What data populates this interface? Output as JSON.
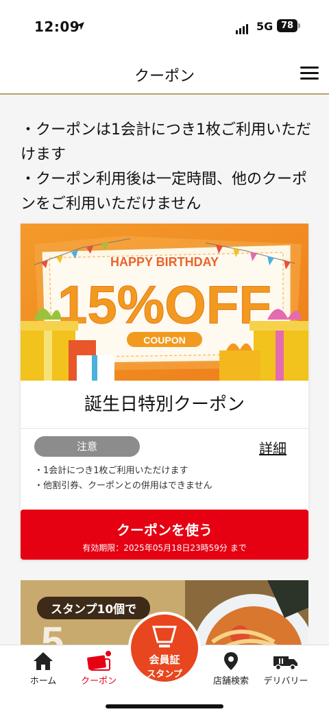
{
  "status_bar": {
    "time": "12:09",
    "network": "5G",
    "battery": "78"
  },
  "header": {
    "title": "クーポン"
  },
  "notice": {
    "line1": "・クーポンは1会計につき1枚ご利用いただけます",
    "line2": "・クーポン利用後は一定時間、他のクーポンをご利用いただけません"
  },
  "coupon": {
    "banner": {
      "top_text": "HAPPY BIRTHDAY",
      "discount": "15%OFF",
      "tag": "COUPON"
    },
    "name": "誕生日特別クーポン",
    "caution_label": "注意",
    "detail_link": "詳細",
    "rules": [
      "・1会計につき1枚ご利用いただけます",
      "・他割引券、クーポンとの併用はできません"
    ],
    "use_button": "クーポンを使う",
    "expiry": "有効期限：2025年05月18日23時59分 まで"
  },
  "coupon2": {
    "stamp_text": "スタンプ10個で"
  },
  "tabs": [
    {
      "label": "ホーム",
      "icon": "home-icon"
    },
    {
      "label": "クーポン",
      "icon": "ticket-icon",
      "active": true
    },
    {
      "label": "店舗検索",
      "icon": "location-pin-icon"
    },
    {
      "label": "デリバリー",
      "icon": "delivery-truck-icon"
    }
  ],
  "center_button": {
    "line1": "会員証",
    "line2": "スタンプ"
  },
  "colors": {
    "accent": "#e50012",
    "center": "#e8461e",
    "gold": "#b8a366"
  }
}
